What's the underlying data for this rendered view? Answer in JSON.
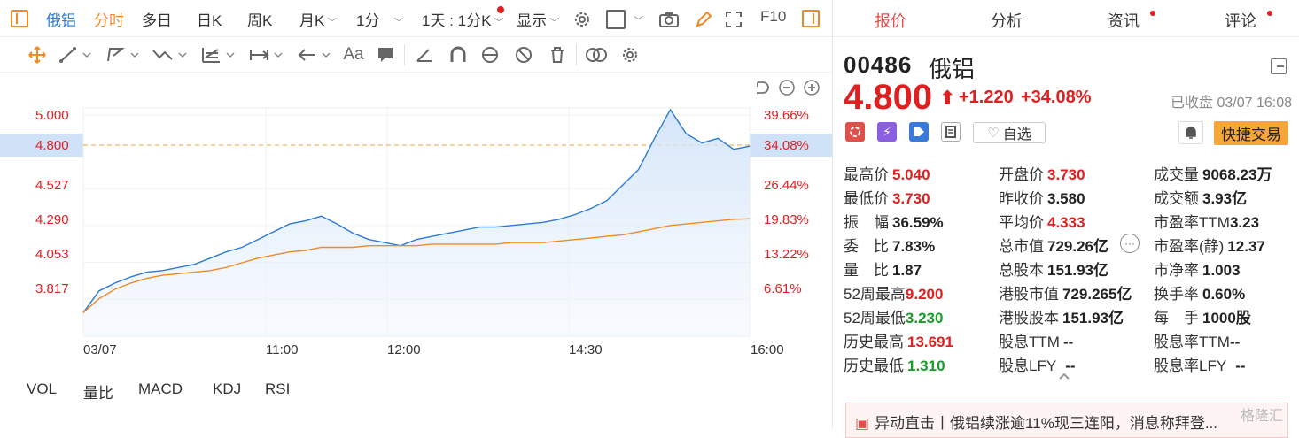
{
  "toolbar": {
    "stock_name": "俄铝",
    "tabs": [
      "分时",
      "多日",
      "日K",
      "周K",
      "月K",
      "1分"
    ],
    "period_select": "1天 : 1分K",
    "display": "显示",
    "f10": "F10"
  },
  "chart": {
    "y_labels": [
      "5.000",
      "4.800",
      "4.527",
      "4.290",
      "4.053",
      "3.817"
    ],
    "pct_labels": [
      "39.66%",
      "34.08%",
      "26.44%",
      "19.83%",
      "13.22%",
      "6.61%"
    ],
    "x_labels": [
      "03/07",
      "11:00",
      "12:00",
      "14:30",
      "16:00"
    ],
    "indicators": [
      "VOL",
      "量比",
      "MACD",
      "KDJ",
      "RSI"
    ]
  },
  "chart_data": {
    "type": "line",
    "ylim": [
      3.58,
      5.04
    ],
    "series": [
      {
        "values": [
          3.73,
          3.87,
          3.92,
          3.96,
          3.99,
          4.0,
          4.02,
          4.04,
          4.08,
          4.12,
          4.15,
          4.2,
          4.25,
          4.3,
          4.32,
          4.35,
          4.3,
          4.24,
          4.2,
          4.18,
          4.16,
          4.2,
          4.22,
          4.24,
          4.26,
          4.28,
          4.28,
          4.29,
          4.3,
          4.31,
          4.33,
          4.36,
          4.4,
          4.45,
          4.55,
          4.65,
          4.85,
          5.04,
          4.88,
          4.82,
          4.85,
          4.78,
          4.8
        ]
      },
      {
        "values": [
          3.73,
          3.82,
          3.88,
          3.92,
          3.95,
          3.97,
          3.98,
          3.99,
          4.0,
          4.02,
          4.05,
          4.08,
          4.1,
          4.12,
          4.13,
          4.15,
          4.15,
          4.15,
          4.16,
          4.16,
          4.16,
          4.16,
          4.17,
          4.17,
          4.17,
          4.17,
          4.17,
          4.18,
          4.18,
          4.18,
          4.19,
          4.2,
          4.21,
          4.22,
          4.23,
          4.25,
          4.27,
          4.29,
          4.3,
          4.31,
          4.32,
          4.33,
          4.333
        ]
      }
    ]
  },
  "quote": {
    "tabs": [
      "报价",
      "分析",
      "资讯",
      "评论"
    ],
    "code": "00486",
    "name": "俄铝",
    "price": "4.800",
    "change": "+1.220",
    "change_pct": "+34.08%",
    "status": "已收盘 03/07 16:08",
    "watch_label": "自选",
    "trade_label": "快捷交易"
  },
  "stats": [
    [
      {
        "l": "最高价",
        "v": "5.040",
        "c": "red"
      },
      {
        "l": "开盘价",
        "v": "3.730",
        "c": "red"
      },
      {
        "l": "成交量",
        "v": "9068.23万",
        "c": "dark"
      }
    ],
    [
      {
        "l": "最低价",
        "v": "3.730",
        "c": "red"
      },
      {
        "l": "昨收价",
        "v": "3.580",
        "c": "dark"
      },
      {
        "l": "成交额",
        "v": "3.93亿",
        "c": "dark"
      }
    ],
    [
      {
        "l": "振　幅",
        "v": "36.59%",
        "c": "dark"
      },
      {
        "l": "平均价",
        "v": "4.333",
        "c": "red"
      },
      {
        "l": "市盈率TTM",
        "v": "3.23",
        "c": "dark"
      }
    ],
    [
      {
        "l": "委　比",
        "v": "7.83%",
        "c": "dark"
      },
      {
        "l": "总市值",
        "v": "729.26亿",
        "c": "dark"
      },
      {
        "l": "市盈率(静)",
        "v": "12.37",
        "c": "dark"
      }
    ],
    [
      {
        "l": "量　比",
        "v": "1.87",
        "c": "dark"
      },
      {
        "l": "总股本",
        "v": "151.93亿",
        "c": "dark"
      },
      {
        "l": "市净率",
        "v": "1.003",
        "c": "dark"
      }
    ],
    [
      {
        "l": "52周最高",
        "v": "9.200",
        "c": "red"
      },
      {
        "l": "港股市值",
        "v": "729.265亿",
        "c": "dark"
      },
      {
        "l": "换手率",
        "v": "0.60%",
        "c": "dark"
      }
    ],
    [
      {
        "l": "52周最低",
        "v": "3.230",
        "c": "green"
      },
      {
        "l": "港股股本",
        "v": "151.93亿",
        "c": "dark"
      },
      {
        "l": "每　手",
        "v": "1000股",
        "c": "dark"
      }
    ],
    [
      {
        "l": "历史最高",
        "v": "13.691",
        "c": "red"
      },
      {
        "l": "股息TTM",
        "v": "--",
        "c": "dark"
      },
      {
        "l": "股息率TTM",
        "v": "--",
        "c": "dark"
      }
    ],
    [
      {
        "l": "历史最低",
        "v": "1.310",
        "c": "green"
      },
      {
        "l": "股息LFY",
        "v": "--",
        "c": "dark"
      },
      {
        "l": "股息率LFY",
        "v": "--",
        "c": "dark"
      }
    ]
  ],
  "news": {
    "text": "异动直击丨俄铝续涨逾11%现三连阳，消息称拜登..."
  },
  "watermark": "格隆汇"
}
